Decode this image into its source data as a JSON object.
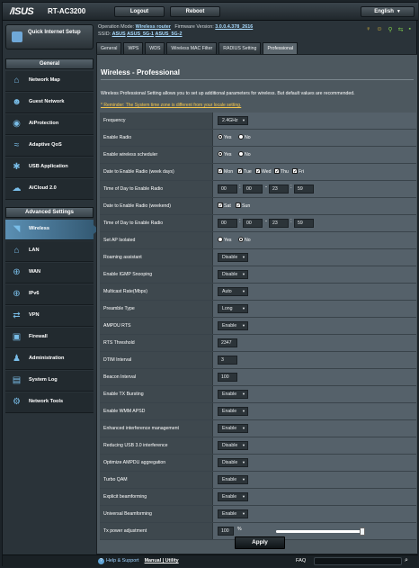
{
  "header": {
    "brand": "/ISUS",
    "model": "RT-AC3200",
    "logout": "Logout",
    "reboot": "Reboot",
    "language": "English"
  },
  "status": {
    "op_mode_label": "Operation Mode:",
    "op_mode_value": "Wireless router",
    "firmware_label": "Firmware Version:",
    "firmware_value": "3.0.0.4.378_2616",
    "ssid_label": "SSID:",
    "ssid_1": "ASUS",
    "ssid_2": "ASUS_5G-1",
    "ssid_3": "ASUS_5G-2"
  },
  "tabs": [
    {
      "label": "General"
    },
    {
      "label": "WPS"
    },
    {
      "label": "WDS"
    },
    {
      "label": "Wireless MAC Filter"
    },
    {
      "label": "RADIUS Setting"
    },
    {
      "label": "Professional"
    }
  ],
  "sidebar": {
    "quick_setup": "Quick Internet Setup",
    "general_header": "General",
    "general_items": [
      {
        "label": "Network Map"
      },
      {
        "label": "Guest Network"
      },
      {
        "label": "AiProtection"
      },
      {
        "label": "Adaptive QoS"
      },
      {
        "label": "USB Application"
      },
      {
        "label": "AiCloud 2.0"
      }
    ],
    "advanced_header": "Advanced Settings",
    "advanced_items": [
      {
        "label": "Wireless"
      },
      {
        "label": "LAN"
      },
      {
        "label": "WAN"
      },
      {
        "label": "IPv6"
      },
      {
        "label": "VPN"
      },
      {
        "label": "Firewall"
      },
      {
        "label": "Administration"
      },
      {
        "label": "System Log"
      },
      {
        "label": "Network Tools"
      }
    ]
  },
  "page": {
    "title": "Wireless - Professional",
    "description": "Wireless Professional Setting allows you to set up additional parameters for wireless. But default values are recommended.",
    "reminder_prefix": "* Reminder: The System time zone is different from your locale setting.",
    "reminder_link": ""
  },
  "form": {
    "frequency_label": "Frequency",
    "frequency_value": "2.4GHz",
    "enable_radio_label": "Enable Radio",
    "enable_scheduler_label": "Enable wireless scheduler",
    "yes": "Yes",
    "no": "No",
    "date_week_label": "Date to Enable Radio (week days)",
    "mon": "Mon",
    "tue": "Tue",
    "wed": "Wed",
    "thu": "Thu",
    "fri": "Fri",
    "time_week_label": "Time of Day to Enable Radio",
    "time_week": [
      "00",
      "00",
      "23",
      "59"
    ],
    "date_weekend_label": "Date to Enable Radio (weekend)",
    "sat": "Sat",
    "sun": "Sun",
    "time_weekend_label": "Time of Day to Enable Radio",
    "time_weekend": [
      "00",
      "00",
      "23",
      "59"
    ],
    "ap_isolated_label": "Set AP Isolated",
    "roaming_label": "Roaming assistant",
    "roaming_value": "Disable",
    "igmp_label": "Enable IGMP Snooping",
    "igmp_value": "Disable",
    "multicast_label": "Multicast Rate(Mbps)",
    "multicast_value": "Auto",
    "preamble_label": "Preamble Type",
    "preamble_value": "Long",
    "ampdu_rts_label": "AMPDU RTS",
    "ampdu_rts_value": "Enable",
    "rts_label": "RTS Threshold",
    "rts_value": "2347",
    "dtim_label": "DTIM Interval",
    "dtim_value": "3",
    "beacon_label": "Beacon Interval",
    "beacon_value": "100",
    "txburst_label": "Enable TX Bursting",
    "txburst_value": "Enable",
    "wmm_apsd_label": "Enable WMM APSD",
    "wmm_apsd_value": "Enable",
    "interference_label": "Enhanced interference management",
    "interference_value": "Enable",
    "usb3_label": "Reducing USB 3.0 interference",
    "usb3_value": "Disable",
    "ampdu_agg_label": "Optimize AMPDU aggregation",
    "ampdu_agg_value": "Disable",
    "turbo_label": "Turbo QAM",
    "turbo_value": "Enable",
    "explicit_label": "Explicit beamforming",
    "explicit_value": "Enable",
    "universal_label": "Universal Beamforming",
    "universal_value": "Enable",
    "txpower_label": "Tx power adjustment",
    "txpower_value": "100",
    "txpower_unit": "%",
    "txpower_fraction": 1.0
  },
  "apply": "Apply",
  "footer": {
    "help": "Help & Support",
    "manual": "Manual | Utility",
    "faq": "FAQ"
  },
  "colors": {
    "accent": "#5b8fb3",
    "reminder": "#f6c74a",
    "link": "#9fd2ff"
  }
}
